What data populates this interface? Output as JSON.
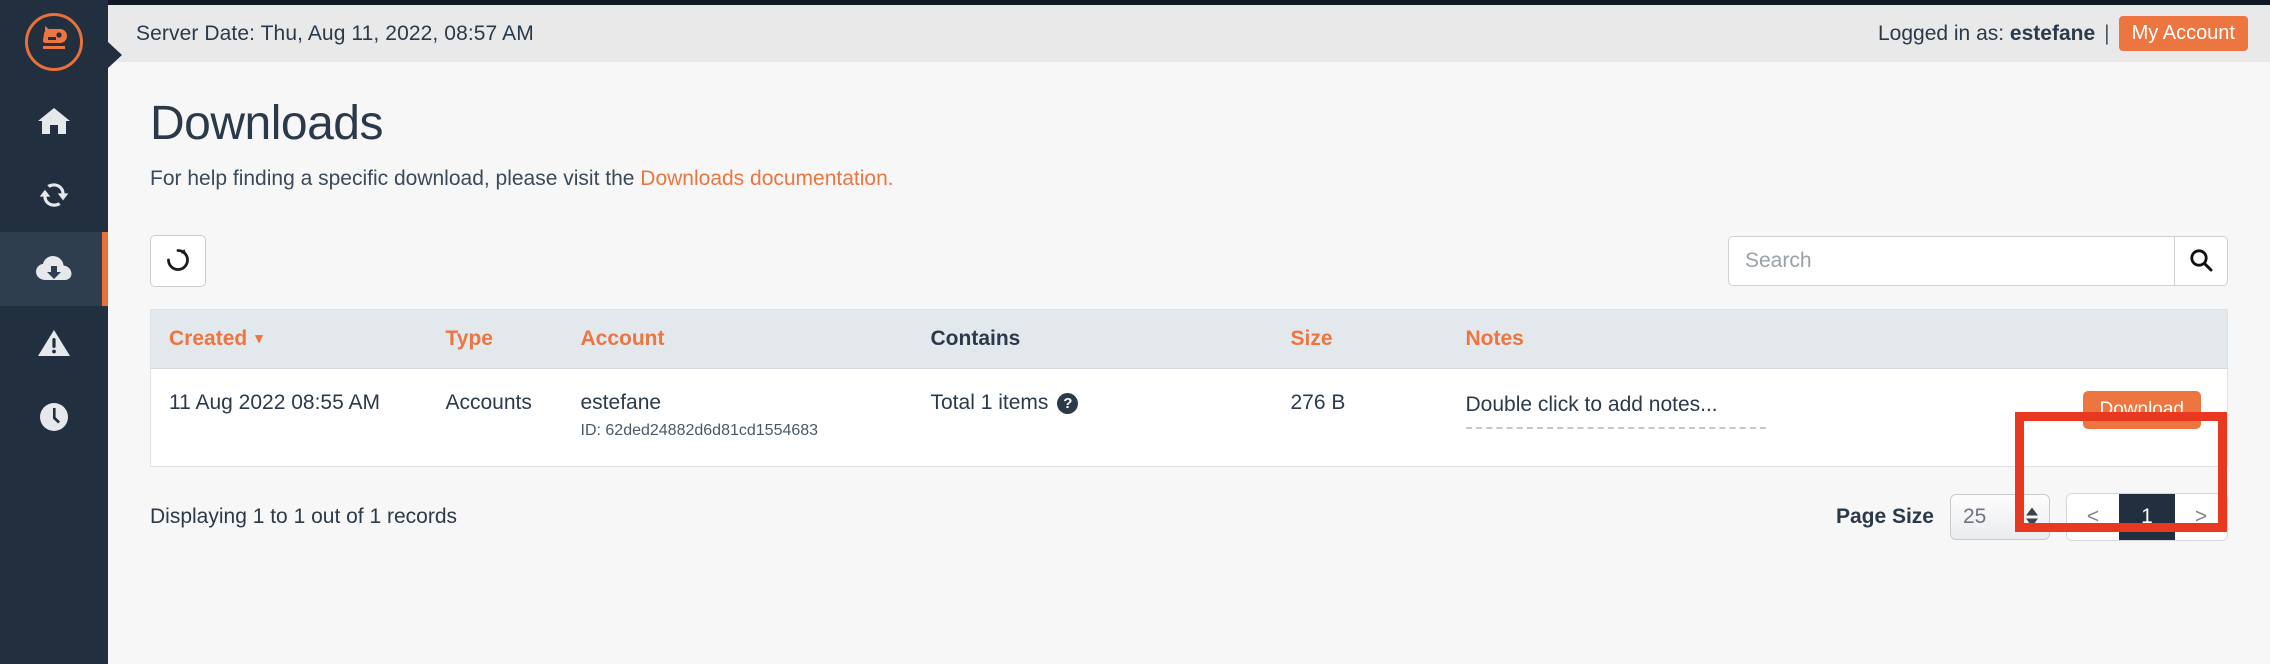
{
  "brand": {
    "logo_icon": "bear-head-logo-icon",
    "accent_color": "#ec7540",
    "sidebar_color": "#222f3e",
    "annotation_color": "#e8381f"
  },
  "sidebar": {
    "items": [
      {
        "name": "home",
        "icon": "home-icon",
        "active": false
      },
      {
        "name": "sync",
        "icon": "sync-refresh-icon",
        "active": false
      },
      {
        "name": "downloads",
        "icon": "cloud-download-icon",
        "active": true
      },
      {
        "name": "alerts",
        "icon": "warning-triangle-icon",
        "active": false
      },
      {
        "name": "history",
        "icon": "clock-icon",
        "active": false
      }
    ]
  },
  "topbar": {
    "server_date": "Server Date: Thu, Aug 11, 2022, 08:57 AM",
    "logged_in_label": "Logged in as: ",
    "username": "estefane",
    "separator": "|",
    "my_account_label": "My Account"
  },
  "page": {
    "title": "Downloads",
    "help_text_before": "For help finding a specific download, please visit the ",
    "help_link_text": "Downloads documentation."
  },
  "toolbar": {
    "refresh_icon": "refresh-icon",
    "search_placeholder": "Search",
    "search_value": "",
    "search_icon": "magnifier-icon"
  },
  "table": {
    "columns": [
      {
        "label": "Created",
        "sorted": true,
        "sort_direction": "desc",
        "highlight": true
      },
      {
        "label": "Type",
        "highlight": true
      },
      {
        "label": "Account",
        "highlight": true
      },
      {
        "label": "Contains",
        "highlight": false
      },
      {
        "label": "Size",
        "highlight": true
      },
      {
        "label": "Notes",
        "highlight": true
      }
    ],
    "rows": [
      {
        "created": "11 Aug 2022 08:55 AM",
        "type": "Accounts",
        "account": "estefane",
        "account_id": "ID: 62ded24882d6d81cd1554683",
        "contains": "Total 1 items",
        "contains_help_icon": "question-mark-icon",
        "size": "276 B",
        "notes": "Double click to add notes...",
        "action_label": "Download"
      }
    ]
  },
  "footer": {
    "records_text": "Displaying 1 to 1 out of 1 records",
    "page_size_label": "Page Size",
    "page_size_value": "25",
    "prev_label": "<",
    "next_label": ">",
    "current_page": "1"
  }
}
